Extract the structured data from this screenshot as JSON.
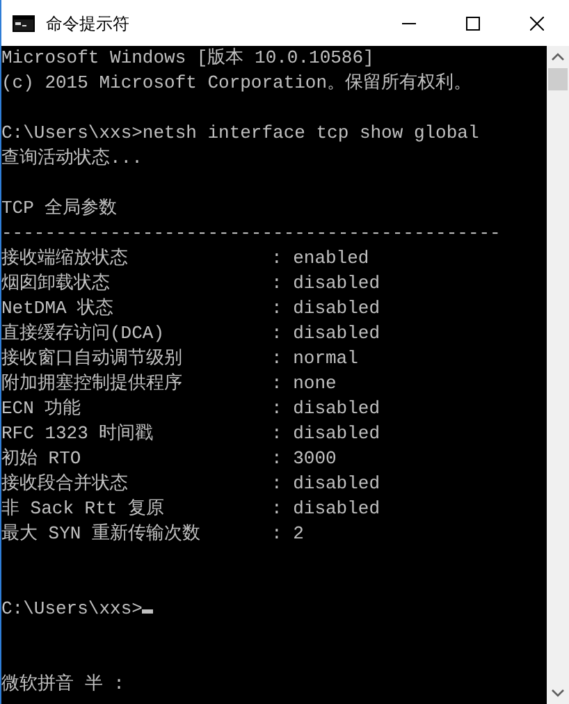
{
  "window": {
    "title": "命令提示符"
  },
  "console": {
    "lines": [
      {
        "kind": "text",
        "text": "Microsoft Windows [版本 10.0.10586]"
      },
      {
        "kind": "text",
        "text": "(c) 2015 Microsoft Corporation。保留所有权利。"
      },
      {
        "kind": "blank"
      },
      {
        "kind": "prompt",
        "text": "C:\\Users\\xxs>netsh interface tcp show global",
        "cursor": false
      },
      {
        "kind": "text",
        "text": "查询活动状态..."
      },
      {
        "kind": "blank"
      },
      {
        "kind": "text",
        "text": "TCP 全局参数"
      },
      {
        "kind": "text",
        "text": "----------------------------------------------"
      },
      {
        "kind": "param",
        "label": "接收端缩放状态",
        "value": ": enabled"
      },
      {
        "kind": "param",
        "label": "烟囱卸载状态",
        "value": ": disabled"
      },
      {
        "kind": "param",
        "label": "NetDMA 状态",
        "value": ": disabled"
      },
      {
        "kind": "param",
        "label": "直接缓存访问(DCA)",
        "value": ": disabled"
      },
      {
        "kind": "param",
        "label": "接收窗口自动调节级别",
        "value": ": normal"
      },
      {
        "kind": "param",
        "label": "附加拥塞控制提供程序",
        "value": ": none"
      },
      {
        "kind": "param",
        "label": "ECN 功能",
        "value": ": disabled"
      },
      {
        "kind": "param",
        "label": "RFC 1323 时间戳",
        "value": ": disabled"
      },
      {
        "kind": "param",
        "label": "初始 RTO",
        "value": ": 3000"
      },
      {
        "kind": "param",
        "label": "接收段合并状态",
        "value": ": disabled"
      },
      {
        "kind": "param",
        "label": "非 Sack Rtt 复原",
        "value": ": disabled"
      },
      {
        "kind": "param",
        "label": "最大 SYN 重新传输次数",
        "value": ": 2"
      },
      {
        "kind": "blank"
      },
      {
        "kind": "blank"
      },
      {
        "kind": "prompt",
        "text": "C:\\Users\\xxs>",
        "cursor": true
      },
      {
        "kind": "blank"
      },
      {
        "kind": "blank"
      },
      {
        "kind": "ime",
        "text": "微软拼音 半 :"
      }
    ]
  }
}
